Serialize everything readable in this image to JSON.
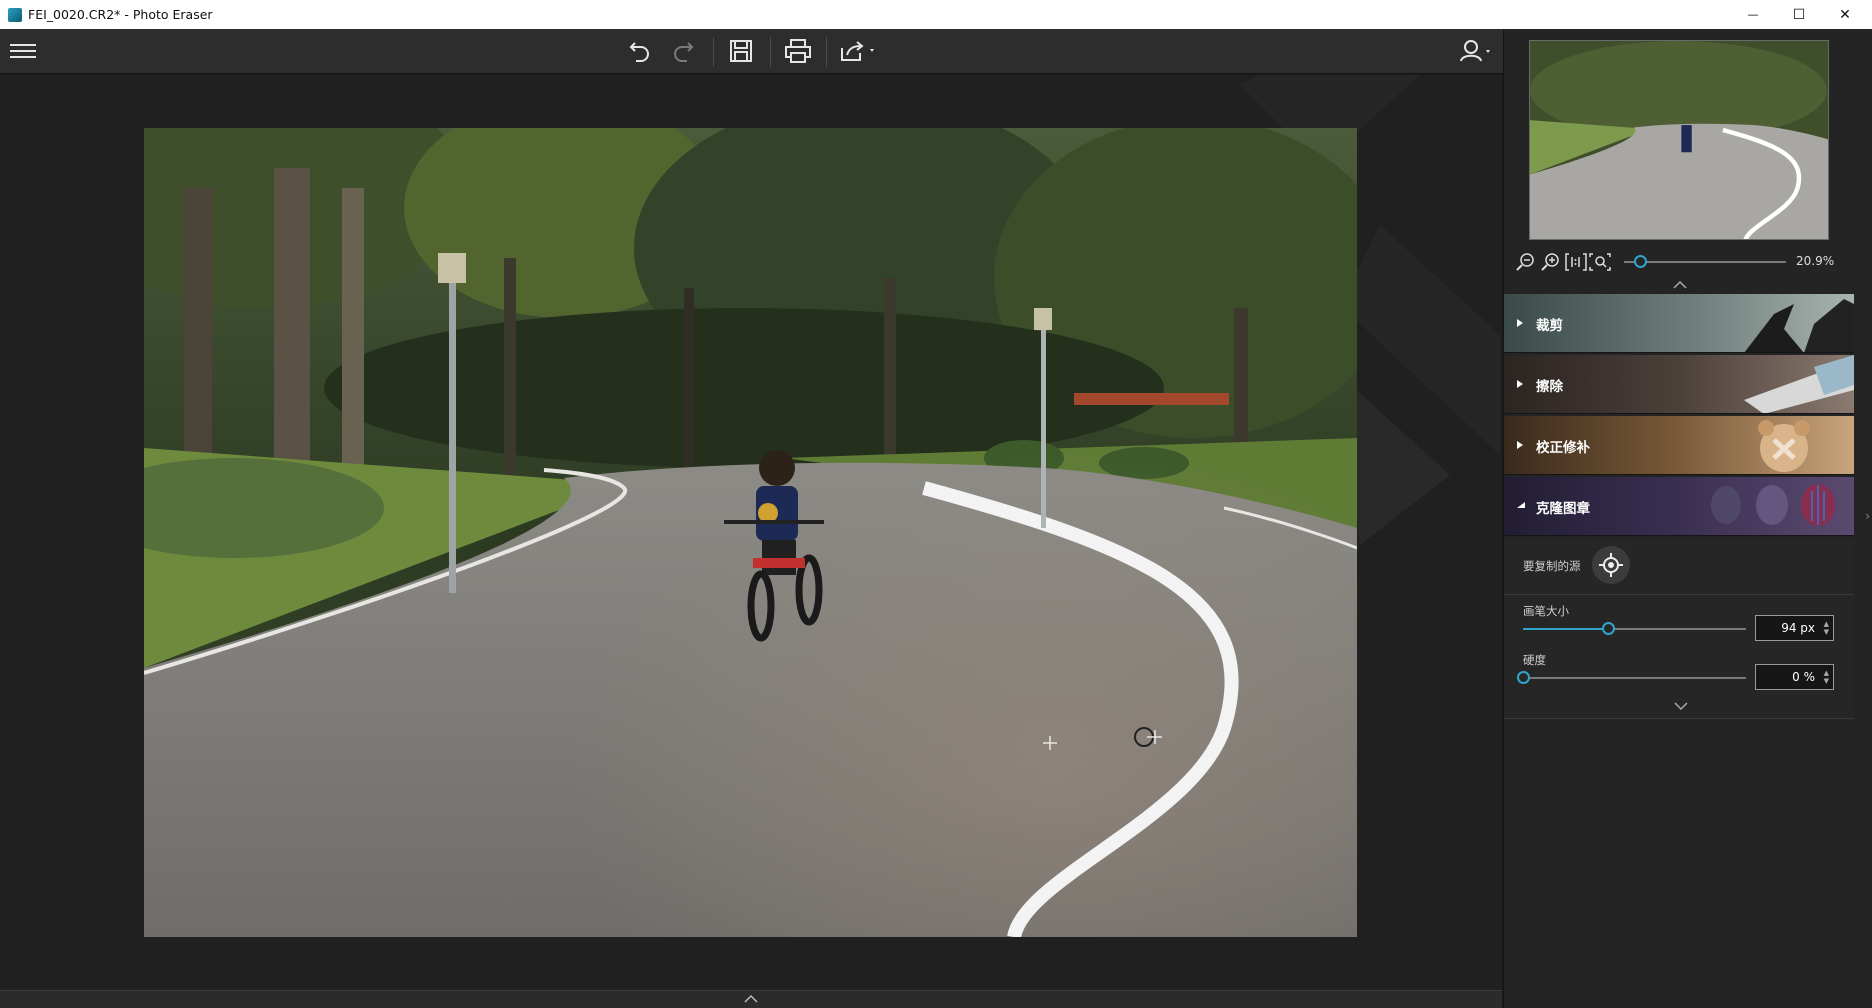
{
  "window": {
    "title": "FEI_0020.CR2* - Photo Eraser",
    "minimize": "—",
    "maximize": "☐",
    "close": "✕"
  },
  "toolbar": {
    "menu_icon": "hamburger-icon",
    "undo_icon": "undo-icon",
    "redo_icon": "redo-icon",
    "save_icon": "save-icon",
    "print_icon": "print-icon",
    "share_icon": "share-icon",
    "account_icon": "user-icon"
  },
  "navigator": {
    "zoom_value": "20.9%",
    "zoom_level": 0.1
  },
  "panels": [
    {
      "label": "裁剪",
      "expanded": false
    },
    {
      "label": "擦除",
      "expanded": false
    },
    {
      "label": "校正修补",
      "expanded": false
    },
    {
      "label": "克隆图章",
      "expanded": true
    }
  ],
  "clone_stamp": {
    "source_label": "要复制的源",
    "brush_size_label": "画笔大小",
    "brush_size_value": "94 px",
    "brush_size_level": 0.38,
    "hardness_label": "硬度",
    "hardness_value": "0 %",
    "hardness_level": 0.0
  },
  "colors": {
    "accent": "#2fa6c9",
    "panel_bg": "#242424",
    "toolbar_bg": "#2d2d2d"
  }
}
